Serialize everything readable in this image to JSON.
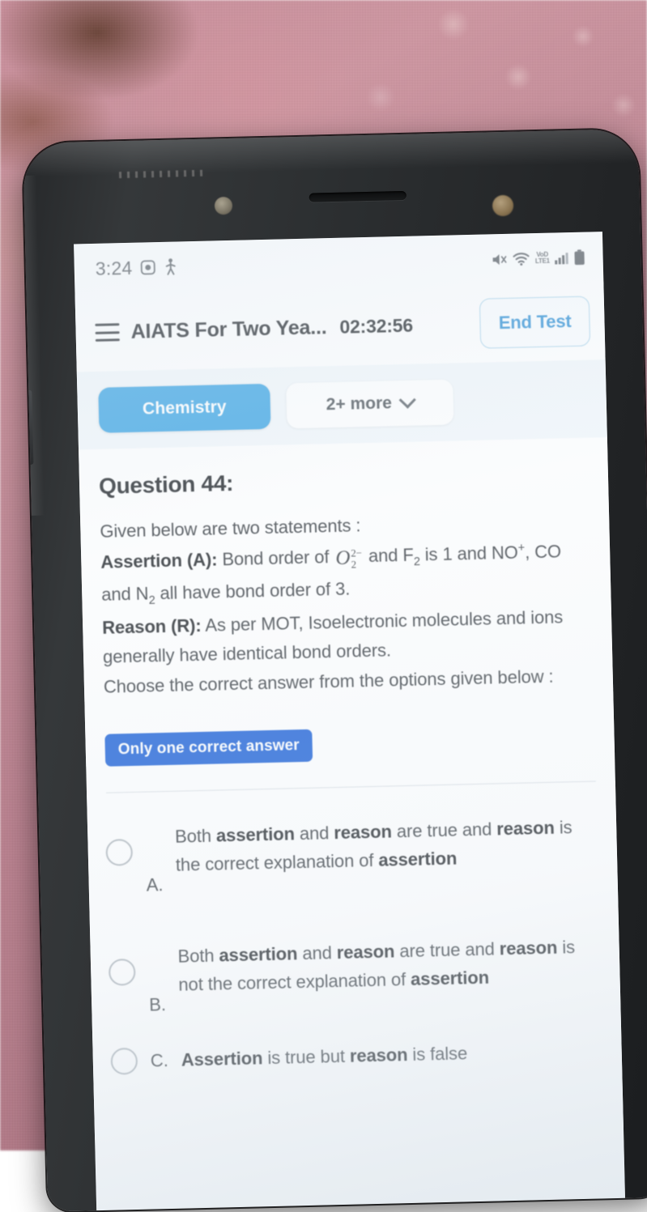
{
  "status_bar": {
    "time": "3:24",
    "left_icons": [
      "screen-record-icon",
      "walking-person-icon"
    ],
    "right_icons": [
      "mute-icon",
      "wifi-icon",
      "volte-lte-icon",
      "signal-bars-icon",
      "battery-icon"
    ],
    "volte_line1": "VoD",
    "volte_line2": "LTE1"
  },
  "header": {
    "menu_icon": "hamburger-menu-icon",
    "title": "AIATS For Two Yea...",
    "timer": "02:32:56",
    "end_test_label": "End Test"
  },
  "tabs": {
    "active": "Chemistry",
    "more_label": "2+ more",
    "more_icon": "chevron-down-icon"
  },
  "question": {
    "title": "Question 44:",
    "intro": "Given below are two statements :",
    "assertion_label": "Assertion (A):",
    "assertion_pre": "Bond order of",
    "assertion_formula_base": "O",
    "assertion_formula_sup": "2−",
    "assertion_formula_sub": "2",
    "assertion_mid": "and F",
    "assertion_f_sub": "2",
    "assertion_after": "is 1 and NO",
    "assertion_no_sup": "+",
    "assertion_tail": ", CO and N",
    "assertion_n_sub": "2",
    "assertion_end": "all have bond order of 3.",
    "reason_label": "Reason (R):",
    "reason_text": "As per MOT, Isoelectronic molecules and ions generally have identical bond orders.",
    "choose_text": "Choose the correct answer from the options given below :",
    "badge": "Only one correct answer"
  },
  "options": [
    {
      "letter": "A.",
      "parts": [
        {
          "t": "Both ",
          "b": false
        },
        {
          "t": "assertion",
          "b": true
        },
        {
          "t": " and ",
          "b": false
        },
        {
          "t": "reason",
          "b": true
        },
        {
          "t": " are true and ",
          "b": false
        },
        {
          "t": "reason",
          "b": true
        },
        {
          "t": " is the correct explanation of ",
          "b": false
        },
        {
          "t": "assertion",
          "b": true
        }
      ],
      "selected": false
    },
    {
      "letter": "B.",
      "parts": [
        {
          "t": "Both ",
          "b": false
        },
        {
          "t": "assertion",
          "b": true
        },
        {
          "t": " and ",
          "b": false
        },
        {
          "t": "reason",
          "b": true
        },
        {
          "t": " are true and ",
          "b": false
        },
        {
          "t": "reason",
          "b": true
        },
        {
          "t": " is not the correct explanation of ",
          "b": false
        },
        {
          "t": "assertion",
          "b": true
        }
      ],
      "selected": false
    },
    {
      "letter": "C.",
      "parts": [
        {
          "t": "Assertion",
          "b": true
        },
        {
          "t": " is true but ",
          "b": false
        },
        {
          "t": "reason",
          "b": true
        },
        {
          "t": " is false",
          "b": false
        }
      ],
      "selected": false,
      "single_line": true
    }
  ],
  "colors": {
    "tab_active": "#3ba4e3",
    "badge_blue": "#1a5fd6",
    "end_test_blue": "#2f90d4",
    "tabstrip_bg": "#f2f7fb"
  }
}
